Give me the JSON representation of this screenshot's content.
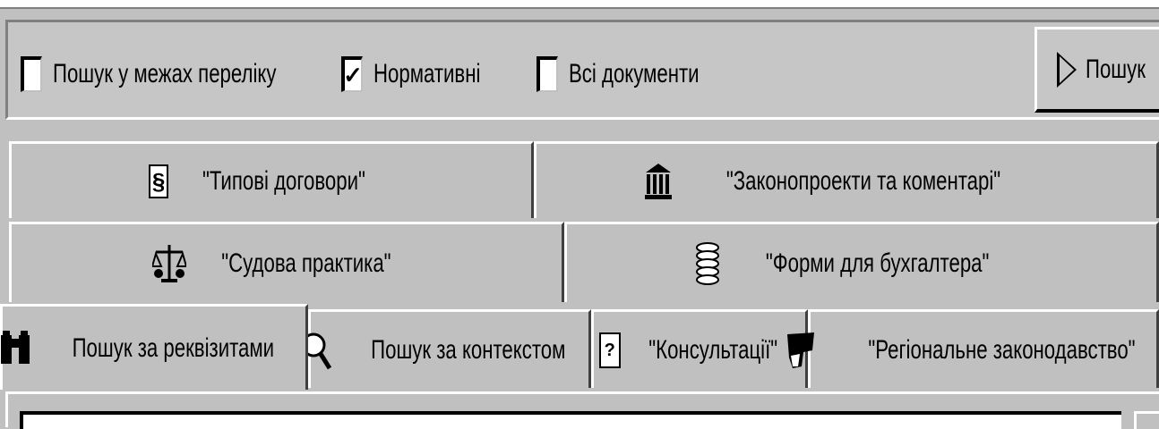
{
  "toolbar": {
    "checkboxes": [
      {
        "label": "Пошук у межах переліку",
        "checked": false
      },
      {
        "label": "Нормативні",
        "checked": true
      },
      {
        "label": "Всі документи",
        "checked": false
      }
    ],
    "search_button": "Пошук",
    "check_glyph": "✓"
  },
  "tabs": {
    "row1": [
      {
        "label": "\"Типові договори\"",
        "icon": "paragraph-icon"
      },
      {
        "label": "\"Законопроекти та коментарі\"",
        "icon": "building-icon"
      }
    ],
    "row2": [
      {
        "label": "\"Судова практика\"",
        "icon": "scales-icon"
      },
      {
        "label": "\"Форми для бухгалтера\"",
        "icon": "coins-icon"
      }
    ],
    "row3": [
      {
        "label": "Пошук за реквізитами",
        "icon": "binoculars-icon",
        "active": true
      },
      {
        "label": "Пошук за контекстом",
        "icon": "magnifier-icon"
      },
      {
        "label": "\"Консультації\"",
        "icon": "question-document-icon"
      },
      {
        "label": "\"Регіональне законодавство\"",
        "icon": "region-map-icon"
      }
    ],
    "paragraph_symbol": "§",
    "question_symbol": "?"
  }
}
